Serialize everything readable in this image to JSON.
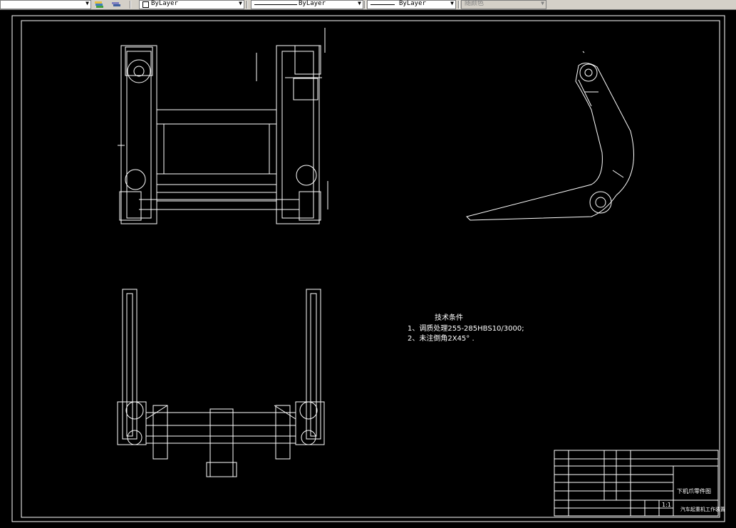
{
  "toolbar": {
    "color_dd": {
      "value": ""
    },
    "layer_dd": {
      "value": "ByLayer"
    },
    "linetype_dd": {
      "value": "ByLayer"
    },
    "lineweight_dd": {
      "value": "ByLayer"
    },
    "plotstyle_dd": {
      "value": "随颜色"
    }
  },
  "drawing": {
    "tech_title": "技术条件",
    "tech_line1": "1、调质处理255-285HBS10/3000;",
    "tech_line2": "2、未注倒角2X45°  ."
  },
  "title_block": {
    "part_name": "下机爪零件图",
    "scale": "1:1",
    "company": "汽车起重机工作装置"
  }
}
